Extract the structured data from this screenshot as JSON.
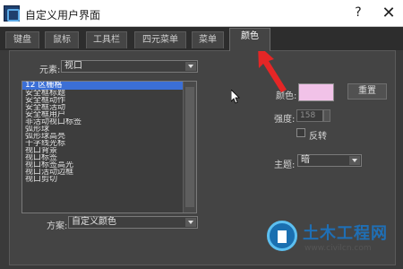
{
  "window": {
    "title": "自定义用户界面",
    "help_glyph": "?",
    "close_glyph": "✕"
  },
  "tabs": [
    {
      "label": "键盘"
    },
    {
      "label": "鼠标"
    },
    {
      "label": "工具栏"
    },
    {
      "label": "四元菜单"
    },
    {
      "label": "菜单"
    },
    {
      "label": "颜色",
      "active": true
    }
  ],
  "color_panel": {
    "element_label": "元素:",
    "element_value": "视口",
    "list_items": [
      "12 区栅格",
      "安全框标题",
      "安全框动作",
      "安全框活动",
      "安全框用户",
      "非活动视口标签",
      "弧形球",
      "弧形球高亮",
      "十字线光标",
      "视口背景",
      "视口标签",
      "视口标签高光",
      "视口活动边框",
      "视口剪切"
    ],
    "selected_index": 0,
    "color_label": "颜色:",
    "color_value": "#f1c2e8",
    "reset_button": "重置",
    "intensity_label": "强度:",
    "intensity_value": "158",
    "invert_label": "反转",
    "invert_checked": false,
    "theme_label": "主题:",
    "theme_value": "暗",
    "scheme_label": "方案:",
    "scheme_value": "自定义颜色"
  },
  "annotation": {
    "arrow_color": "#e52626"
  },
  "watermark": {
    "brand": "土木工程网",
    "url": "www.civilcn.com"
  }
}
